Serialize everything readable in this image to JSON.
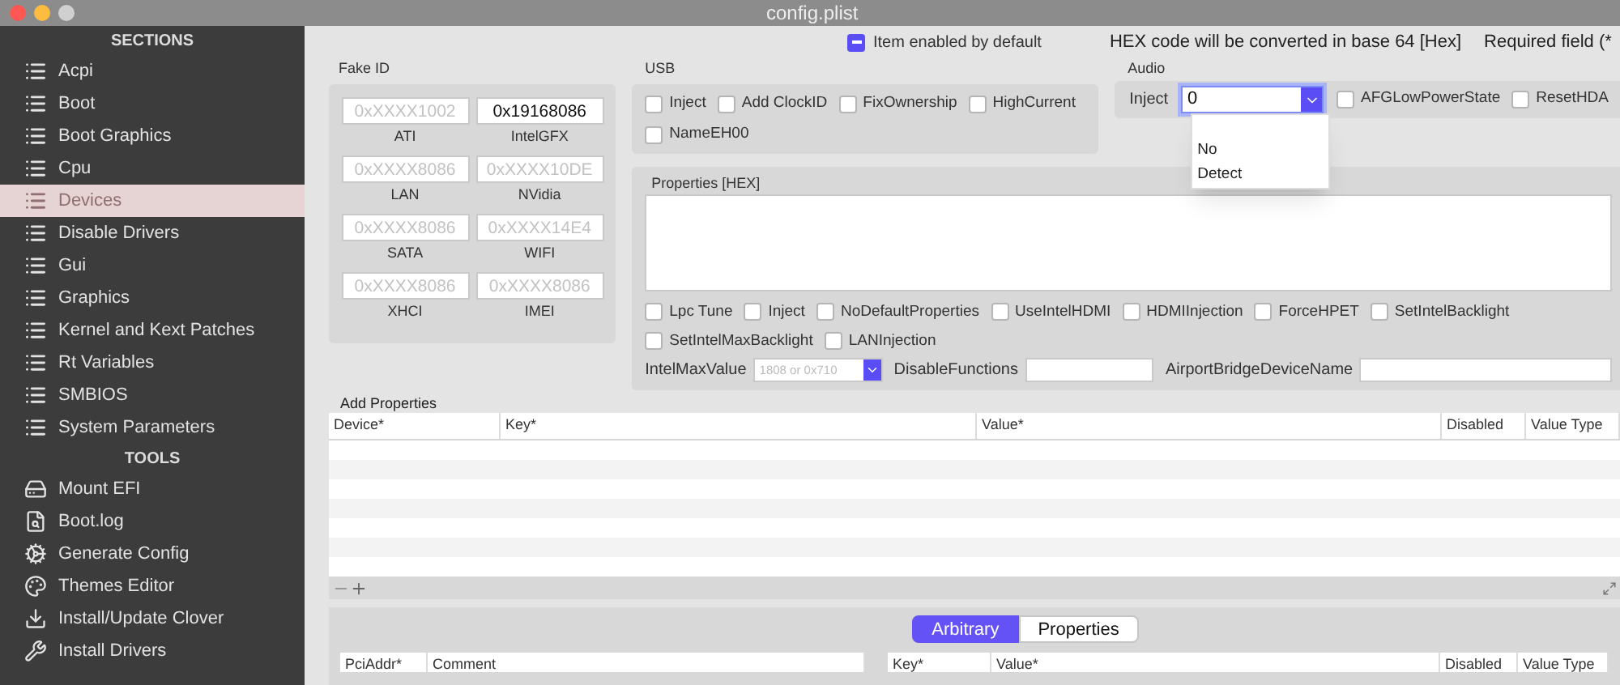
{
  "window": {
    "title": "config.plist"
  },
  "sidebar": {
    "sections_heading": "SECTIONS",
    "sections": [
      {
        "label": "Acpi",
        "selected": false
      },
      {
        "label": "Boot",
        "selected": false
      },
      {
        "label": "Boot Graphics",
        "selected": false
      },
      {
        "label": "Cpu",
        "selected": false
      },
      {
        "label": "Devices",
        "selected": true
      },
      {
        "label": "Disable Drivers",
        "selected": false
      },
      {
        "label": "Gui",
        "selected": false
      },
      {
        "label": "Graphics",
        "selected": false
      },
      {
        "label": "Kernel and Kext Patches",
        "selected": false
      },
      {
        "label": "Rt Variables",
        "selected": false
      },
      {
        "label": "SMBIOS",
        "selected": false
      },
      {
        "label": "System Parameters",
        "selected": false
      }
    ],
    "tools_heading": "TOOLS",
    "tools": [
      {
        "label": "Mount EFI",
        "kind": "disk"
      },
      {
        "label": "Boot.log",
        "kind": "log"
      },
      {
        "label": "Generate Config",
        "kind": "gears"
      },
      {
        "label": "Themes Editor",
        "kind": "palette"
      },
      {
        "label": "Install/Update Clover",
        "kind": "download"
      },
      {
        "label": "Install Drivers",
        "kind": "tools"
      }
    ]
  },
  "header": {
    "item_enabled": {
      "label": "Item enabled by default",
      "mixed": true
    },
    "hex_note": "HEX code will be converted in base 64 [Hex]",
    "required_note": "Required field (*"
  },
  "fake_id": {
    "title": "Fake ID",
    "fields": [
      {
        "label": "ATI",
        "placeholder": "0xXXXX1002"
      },
      {
        "label": "IntelGFX",
        "value": "0x19168086"
      },
      {
        "label": "LAN",
        "placeholder": "0xXXXX8086"
      },
      {
        "label": "NVidia",
        "placeholder": "0xXXXX10DE"
      },
      {
        "label": "SATA",
        "placeholder": "0xXXXX8086"
      },
      {
        "label": "WIFI",
        "placeholder": "0xXXXX14E4"
      },
      {
        "label": "XHCI",
        "placeholder": "0xXXXX8086"
      },
      {
        "label": "IMEI",
        "placeholder": "0xXXXX8086"
      }
    ]
  },
  "usb": {
    "title": "USB",
    "options": [
      {
        "label": "Inject",
        "checked": false
      },
      {
        "label": "Add ClockID",
        "checked": false
      },
      {
        "label": "FixOwnership",
        "checked": false
      },
      {
        "label": "HighCurrent",
        "checked": false
      },
      {
        "label": "NameEH00",
        "checked": false
      }
    ]
  },
  "audio": {
    "title": "Audio",
    "inject_label": "Inject",
    "inject_value": "0",
    "expanded": true,
    "menu_options": [
      "No",
      "Detect"
    ],
    "options": [
      {
        "label": "AFGLowPowerState",
        "checked": false
      },
      {
        "label": "ResetHDA",
        "checked": false
      }
    ]
  },
  "properties": {
    "title": "Properties [HEX]",
    "options": [
      {
        "label": "Lpc Tune",
        "checked": false
      },
      {
        "label": "Inject",
        "checked": false
      },
      {
        "label": "NoDefaultProperties",
        "checked": false
      },
      {
        "label": "UseIntelHDMI",
        "checked": false
      },
      {
        "label": "HDMIInjection",
        "checked": false
      },
      {
        "label": "ForceHPET",
        "checked": false
      },
      {
        "label": "SetIntelBacklight",
        "checked": false
      },
      {
        "label": "SetIntelMaxBacklight",
        "checked": false
      },
      {
        "label": "LANInjection",
        "checked": false
      }
    ],
    "intel_max_value": {
      "label": "IntelMaxValue",
      "placeholder": "1808 or 0x710"
    },
    "disable_functions": {
      "label": "DisableFunctions"
    },
    "airport_bridge": {
      "label": "AirportBridgeDeviceName"
    }
  },
  "add_properties": {
    "title": "Add Properties",
    "columns": [
      "Device*",
      "Key*",
      "Value*",
      "Disabled",
      "Value Type"
    ]
  },
  "segments": [
    {
      "label": "Arbitrary",
      "selected": true
    },
    {
      "label": "Properties",
      "selected": false
    }
  ],
  "arbitrary": {
    "left_columns": [
      "PciAddr*",
      "Comment"
    ],
    "right_columns": [
      "Key*",
      "Value*",
      "Disabled",
      "Value Type"
    ]
  }
}
